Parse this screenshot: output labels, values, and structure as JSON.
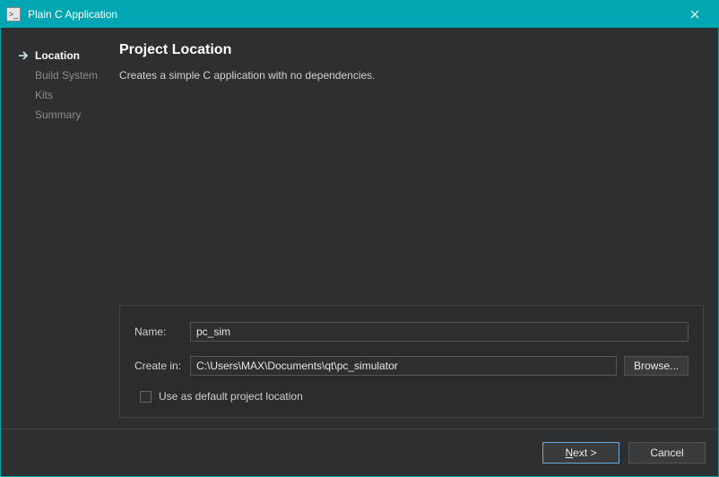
{
  "window": {
    "title": "Plain C Application"
  },
  "sidebar": {
    "steps": [
      {
        "label": "Location",
        "active": true
      },
      {
        "label": "Build System",
        "active": false
      },
      {
        "label": "Kits",
        "active": false
      },
      {
        "label": "Summary",
        "active": false
      }
    ]
  },
  "main": {
    "heading": "Project Location",
    "description": "Creates a simple C application with no dependencies."
  },
  "form": {
    "name_label": "Name:",
    "name_value": "pc_sim",
    "path_label": "Create in:",
    "path_value": "C:\\Users\\MAX\\Documents\\qt\\pc_simulator",
    "browse_label": "Browse...",
    "default_checkbox_label": "Use as default project location",
    "default_checked": false
  },
  "footer": {
    "next_full": "Next >",
    "next_accel": "N",
    "next_rest": "ext >",
    "cancel": "Cancel"
  }
}
